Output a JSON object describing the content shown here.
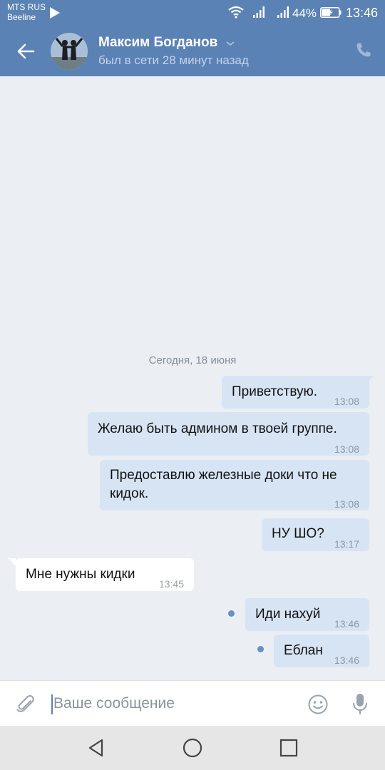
{
  "status_bar": {
    "carrier_1": "MTS RUS",
    "carrier_2": "Beeline",
    "battery": "44%",
    "time": "13:46"
  },
  "header": {
    "contact_name": "Максим Богданов",
    "last_seen": "был в сети 28 минут назад"
  },
  "chat": {
    "date_separator": "Сегодня, 18 июня",
    "messages": [
      {
        "direction": "out",
        "text": "Приветствую.",
        "time": "13:08",
        "unread": false
      },
      {
        "direction": "out",
        "text": "Желаю быть админом в твоей группе.",
        "time": "13:08",
        "unread": false
      },
      {
        "direction": "out",
        "line1": "Предоставлю железные доки что не",
        "line2": "кидок.",
        "time": "13:08",
        "unread": false
      },
      {
        "direction": "out",
        "text": "НУ ШО?",
        "time": "13:17",
        "unread": false
      },
      {
        "direction": "in",
        "text": "Мне нужны кидки",
        "time": "13:45"
      },
      {
        "direction": "out",
        "text": "Иди нахуй",
        "time": "13:46",
        "unread": true
      },
      {
        "direction": "out",
        "text": "Еблан",
        "time": "13:46",
        "unread": true
      }
    ]
  },
  "composer": {
    "placeholder": "Ваше сообщение"
  },
  "colors": {
    "header_blue": "#5b82b5",
    "outgoing_bubble": "#d7e4f3",
    "incoming_bubble": "#ffffff",
    "background": "#ebeff4",
    "unread_dot": "#6a8fc3"
  },
  "icons": [
    "play-icon",
    "wifi-icon",
    "signal-icon",
    "battery-icon",
    "back-arrow-icon",
    "chevron-down-icon",
    "phone-icon",
    "attach-icon",
    "smile-icon",
    "mic-icon",
    "nav-back-icon",
    "nav-home-icon",
    "nav-recents-icon"
  ]
}
